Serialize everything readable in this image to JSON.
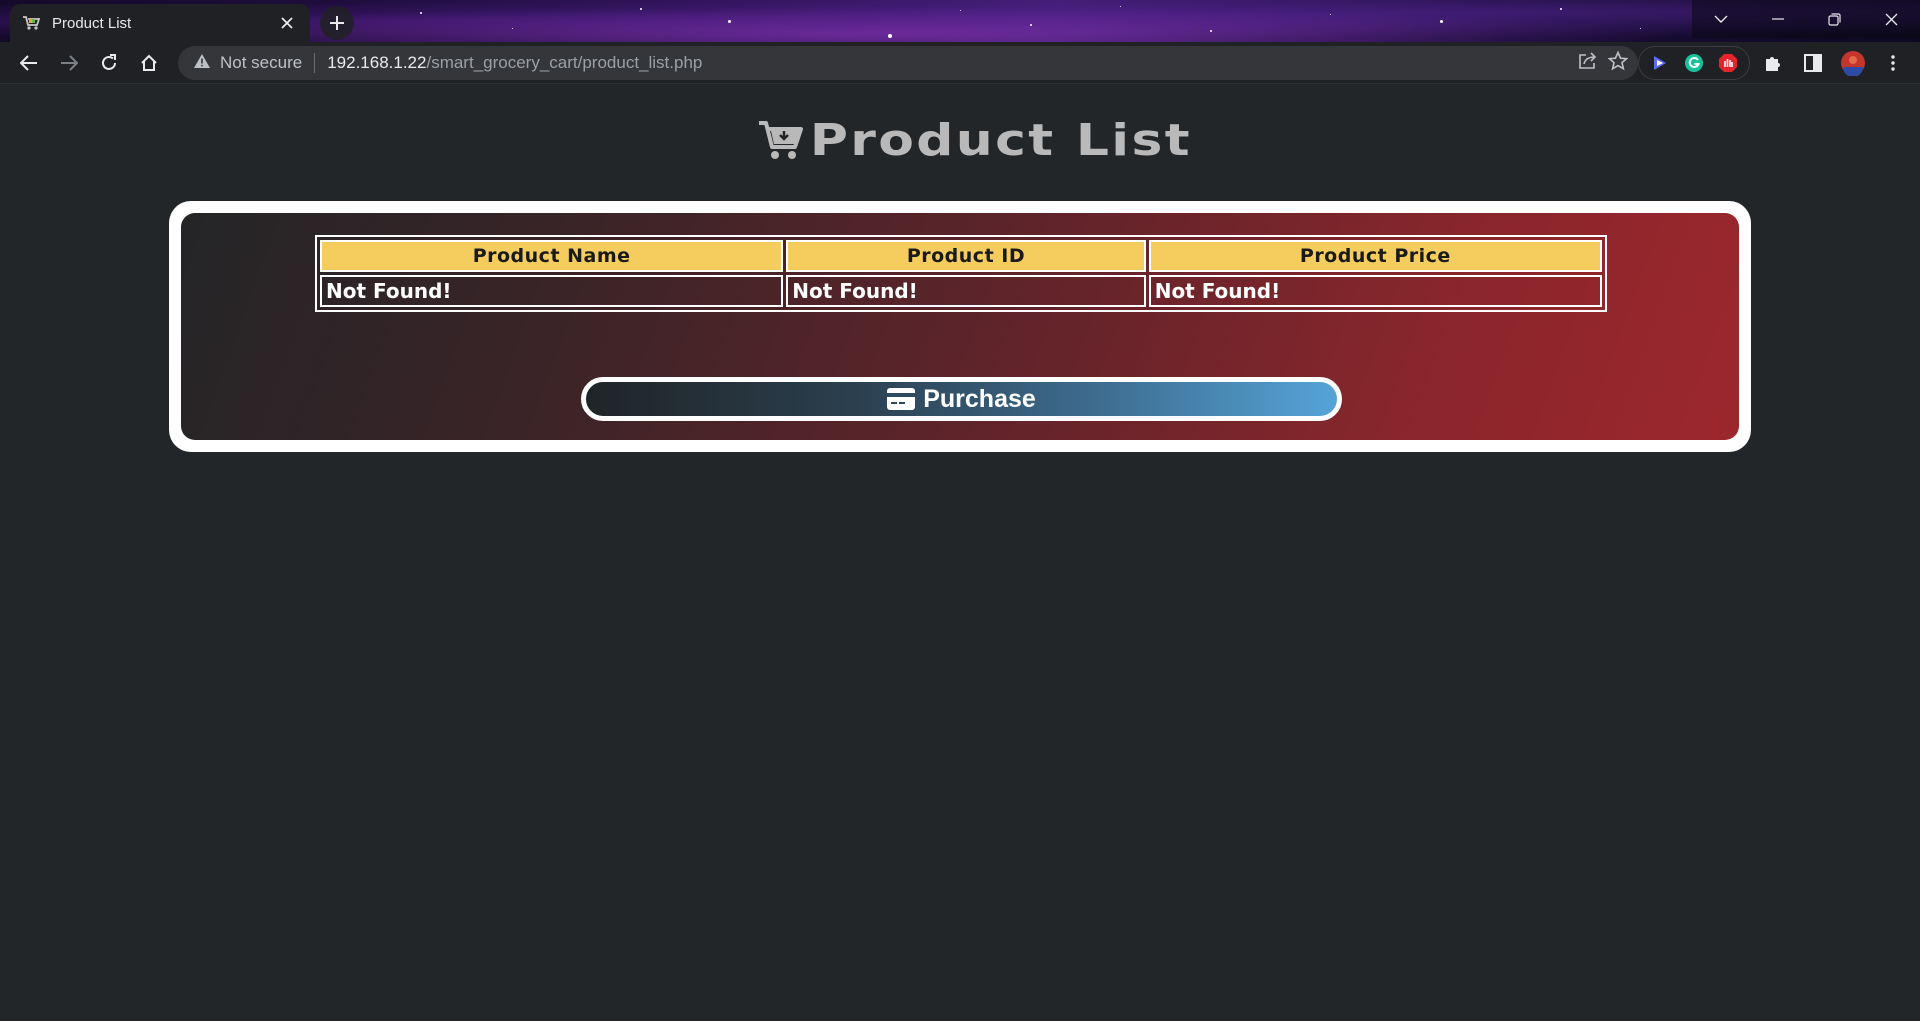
{
  "browser": {
    "tab": {
      "title": "Product List"
    },
    "address_bar": {
      "security_label": "Not secure",
      "url_host": "192.168.1.22",
      "url_path": "/smart_grocery_cart/product_list.php"
    },
    "extension_icons": [
      "copilot-icon",
      "grammarly-icon",
      "adblock-icon",
      "puzzle-icon"
    ]
  },
  "page": {
    "title": "Product List",
    "table": {
      "headers": [
        "Product Name",
        "Product ID",
        "Product Price"
      ],
      "rows": [
        [
          "Not Found!",
          "Not Found!",
          "Not Found!"
        ]
      ]
    },
    "purchase_label": "Purchase"
  },
  "colors": {
    "table_header": "#f5cd5e",
    "panel_gradient_start": "#242527",
    "panel_gradient_end": "#9c272d",
    "button_gradient_end": "#55a4d8"
  }
}
